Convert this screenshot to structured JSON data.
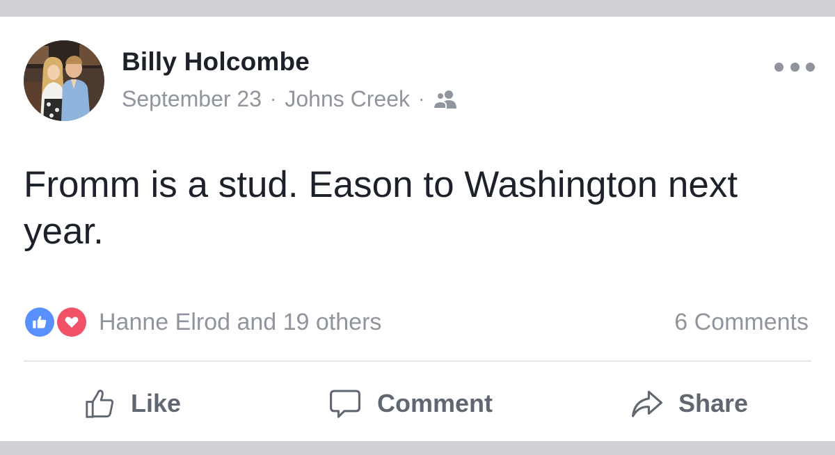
{
  "post": {
    "author": "Billy Holcombe",
    "date": "September 23",
    "location": "Johns Creek",
    "separator": "·",
    "audience_icon": "friends-icon",
    "text": "Fromm is a stud. Eason to Washington next year.",
    "more_icon": "more-options-icon"
  },
  "reactions": {
    "icons": [
      "like-reaction-icon",
      "love-reaction-icon"
    ],
    "summary": "Hanne Elrod and 19 others",
    "comments": "6 Comments"
  },
  "actions": {
    "like": "Like",
    "comment": "Comment",
    "share": "Share"
  },
  "colors": {
    "text": "#1d2129",
    "secondary_text": "#90949c",
    "action_text": "#606770",
    "like_blue": "#5890ff",
    "love_red": "#f25268",
    "frame_gray": "#d0d1d5"
  }
}
